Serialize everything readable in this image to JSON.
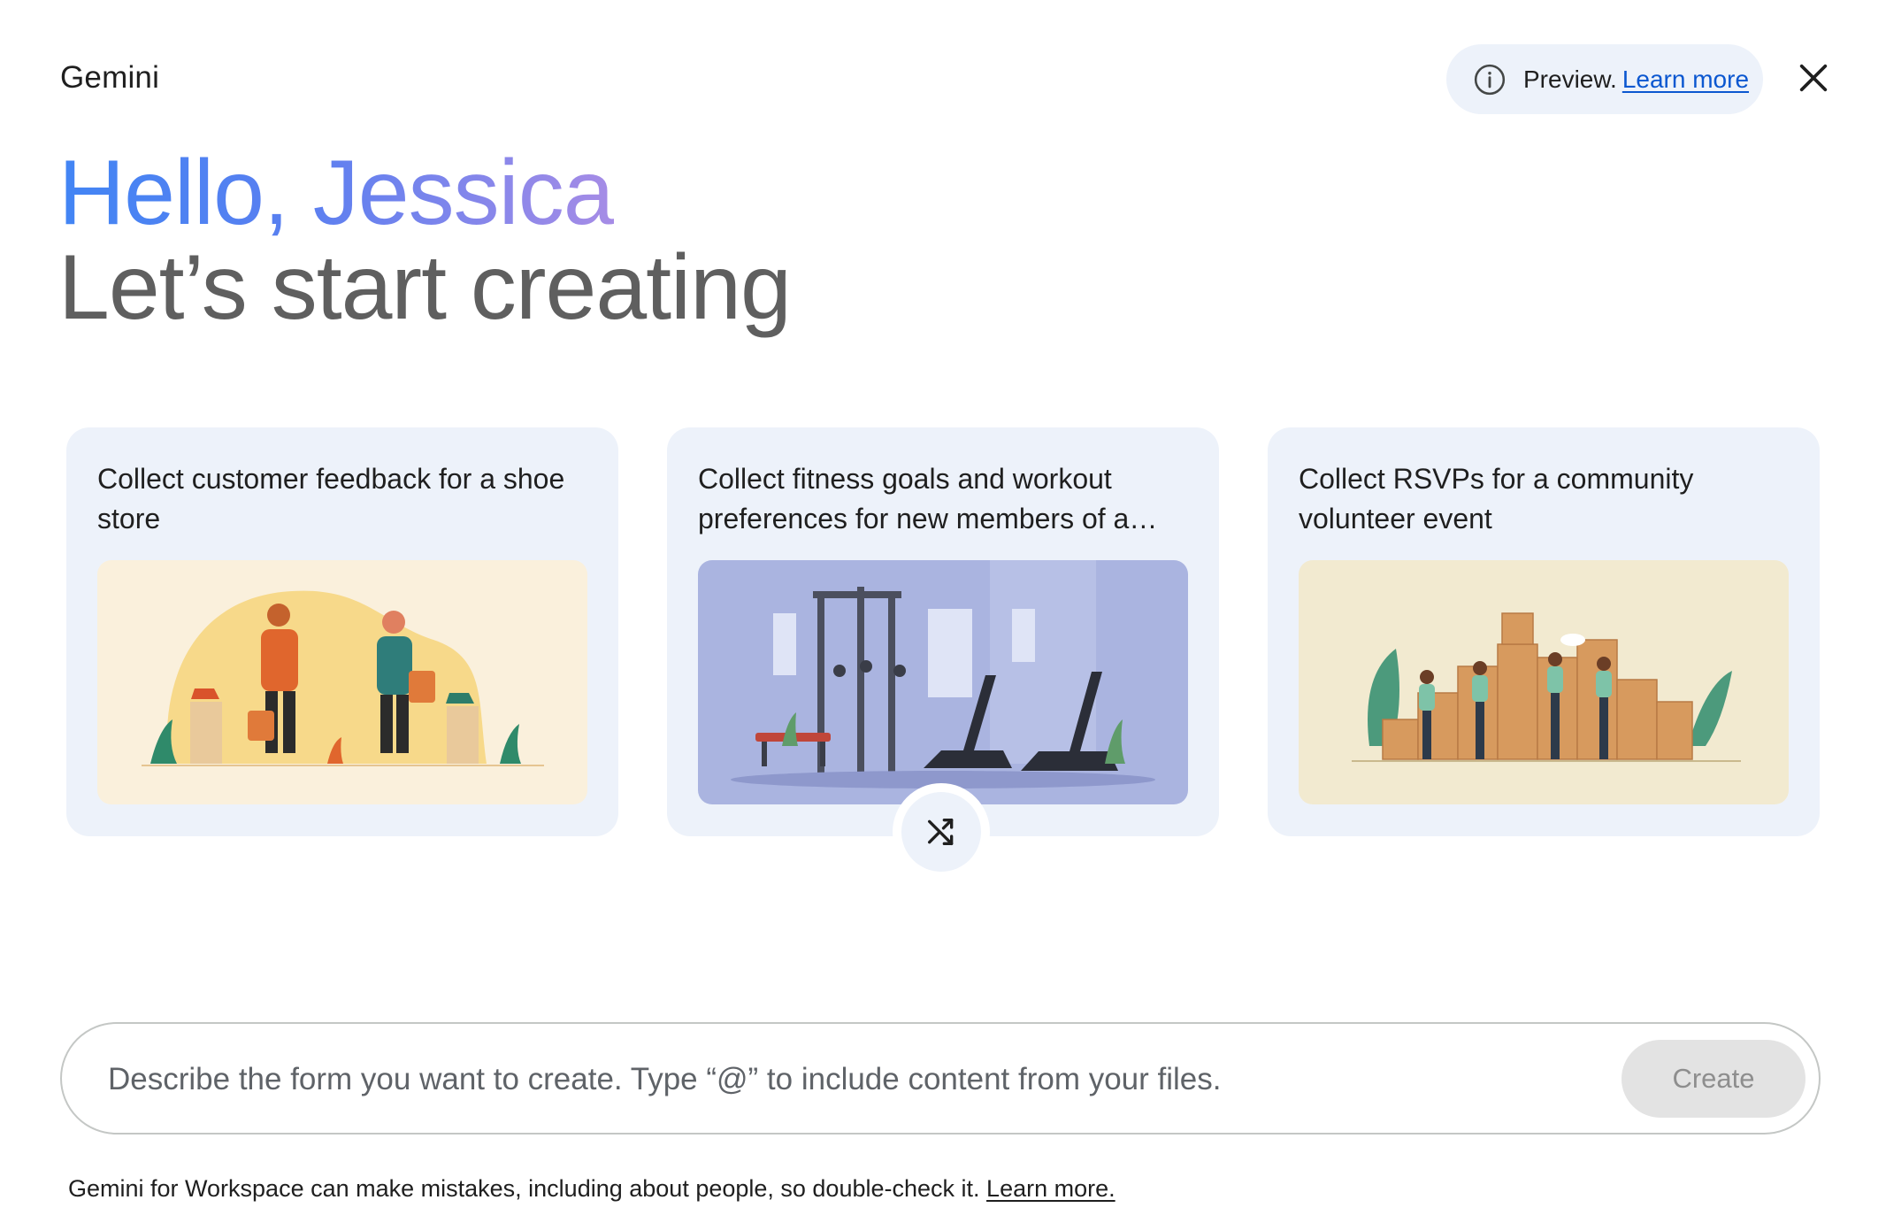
{
  "app": {
    "title": "Gemini"
  },
  "header": {
    "preview_label": "Preview.",
    "preview_link": "Learn more",
    "close_label": "Close"
  },
  "hero": {
    "greeting": "Hello, Jessica",
    "subhead": "Let’s start creating"
  },
  "cards": [
    {
      "title": "Collect customer feedback for a shoe store",
      "illustration": "shoe-store-shoppers"
    },
    {
      "title": "Collect fitness goals and workout preferences for new members of a…",
      "illustration": "gym-equipment"
    },
    {
      "title": "Collect RSVPs for a community volunteer event",
      "illustration": "volunteers-with-boxes"
    }
  ],
  "shuffle": {
    "icon": "shuffle-icon"
  },
  "prompt": {
    "placeholder": "Describe the form you want to create. Type “@” to include content from your files.",
    "value": "",
    "create_label": "Create"
  },
  "footer": {
    "disclaimer": "Gemini for Workspace can make mistakes, including about people, so double-check it.",
    "link": "Learn more."
  },
  "colors": {
    "accent_blue": "#4285f4",
    "accent_purple": "#a68ce6",
    "card_bg": "#edf2fa",
    "link": "#0b57d0"
  }
}
